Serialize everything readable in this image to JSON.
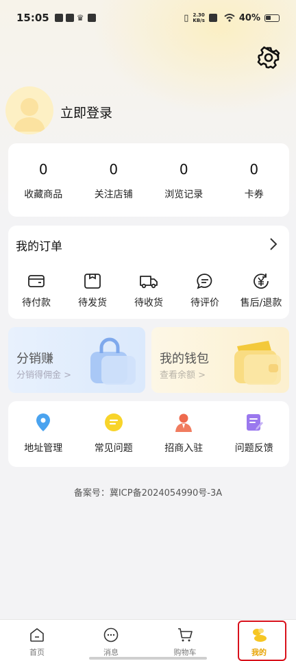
{
  "status_bar": {
    "time": "15:05",
    "net_speed_top": "2.30",
    "net_speed_bottom": "KB/s",
    "battery": "40%"
  },
  "profile": {
    "login_label": "立即登录"
  },
  "stats": [
    {
      "value": "0",
      "label": "收藏商品"
    },
    {
      "value": "0",
      "label": "关注店铺"
    },
    {
      "value": "0",
      "label": "浏览记录"
    },
    {
      "value": "0",
      "label": "卡券"
    }
  ],
  "orders": {
    "title": "我的订单",
    "items": [
      {
        "label": "待付款",
        "icon": "wallet-icon"
      },
      {
        "label": "待发货",
        "icon": "package-icon"
      },
      {
        "label": "待收货",
        "icon": "truck-icon"
      },
      {
        "label": "待评价",
        "icon": "comment-icon"
      },
      {
        "label": "售后/退款",
        "icon": "refund-icon"
      }
    ]
  },
  "promos": {
    "distribution": {
      "title": "分销赚",
      "subtitle": "分销得佣金 >"
    },
    "wallet": {
      "title": "我的钱包",
      "subtitle": "查看余额 >"
    }
  },
  "tools": [
    {
      "label": "地址管理",
      "icon": "location-icon"
    },
    {
      "label": "常见问题",
      "icon": "faq-icon"
    },
    {
      "label": "招商入驻",
      "icon": "merchant-icon"
    },
    {
      "label": "问题反馈",
      "icon": "feedback-icon"
    }
  ],
  "icp": "备案号：冀ICP备2024054990号-3A",
  "tabbar": [
    {
      "label": "首页",
      "icon": "home-icon"
    },
    {
      "label": "消息",
      "icon": "message-icon"
    },
    {
      "label": "购物车",
      "icon": "cart-icon"
    },
    {
      "label": "我的",
      "icon": "profile-icon",
      "active": true
    }
  ],
  "colors": {
    "accent": "#e7a300",
    "highlight_border": "#d8101a"
  }
}
